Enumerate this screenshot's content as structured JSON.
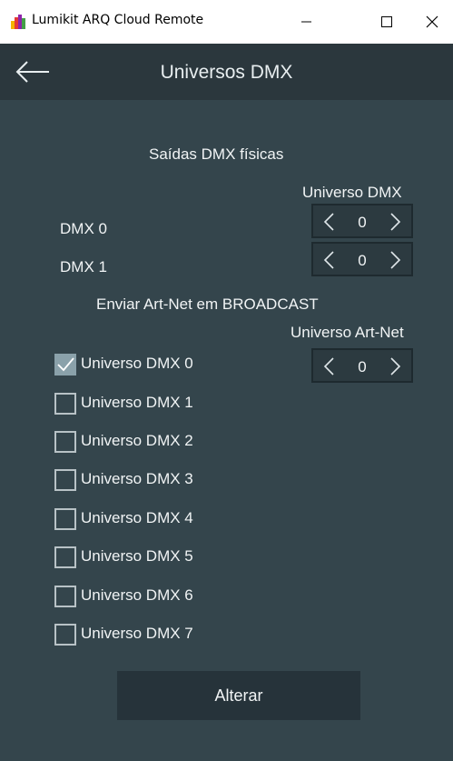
{
  "window": {
    "title": "Lumikit ARQ Cloud Remote",
    "minimize_icon": "minimize-icon",
    "maximize_icon": "maximize-icon",
    "close_icon": "close-icon"
  },
  "header": {
    "back_icon": "back-arrow-icon",
    "title": "Universos DMX"
  },
  "physical_outputs": {
    "title": "Saídas DMX físicas",
    "column_label": "Universo DMX",
    "rows": [
      {
        "label": "DMX 0",
        "value": "0"
      },
      {
        "label": "DMX 1",
        "value": "0"
      }
    ]
  },
  "artnet": {
    "title": "Enviar Art-Net em BROADCAST",
    "column_label": "Universo Art-Net",
    "value": "0",
    "checkboxes": [
      {
        "label": "Universo DMX 0",
        "checked": true
      },
      {
        "label": "Universo DMX 1",
        "checked": false
      },
      {
        "label": "Universo DMX 2",
        "checked": false
      },
      {
        "label": "Universo DMX 3",
        "checked": false
      },
      {
        "label": "Universo DMX 4",
        "checked": false
      },
      {
        "label": "Universo DMX 5",
        "checked": false
      },
      {
        "label": "Universo DMX 6",
        "checked": false
      },
      {
        "label": "Universo DMX 7",
        "checked": false
      }
    ]
  },
  "actions": {
    "apply_label": "Alterar"
  },
  "colors": {
    "background": "#34454c",
    "header": "#2b373d",
    "button": "#26333a",
    "checkbox_checked": "#8aa1aa"
  }
}
